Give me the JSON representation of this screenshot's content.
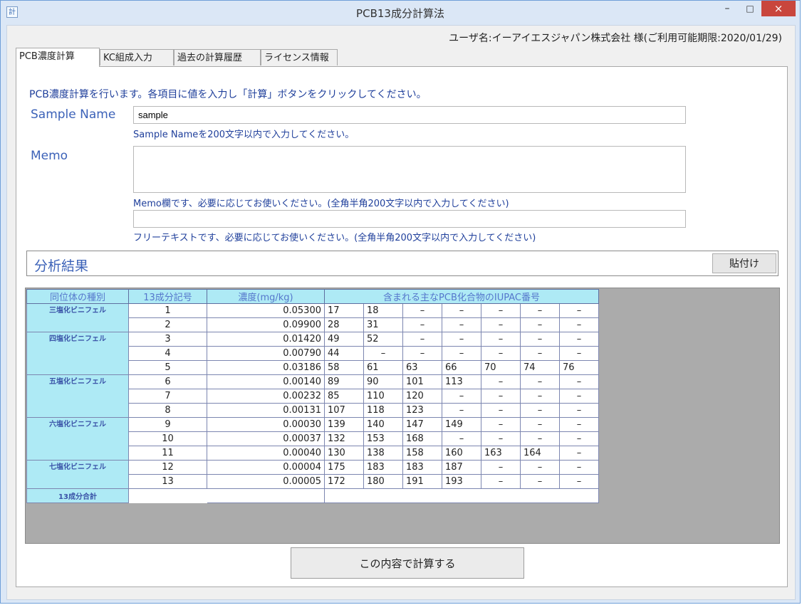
{
  "window": {
    "title": "PCB13成分計算法",
    "app_icon": "app-icon",
    "minimize": "–",
    "maximize": "□",
    "close": "×"
  },
  "user_info": "ユーザ名:イーアイエスジャパン株式会社 様(ご利用可能期限:2020/01/29)",
  "tabs": [
    "PCB濃度計算",
    "KC組成入力",
    "過去の計算履歴",
    "ライセンス情報"
  ],
  "intro": "PCB濃度計算を行います。各項目に値を入力し「計算」ボタンをクリックしてください。",
  "sample_name": {
    "label": "Sample Name",
    "value": "sample",
    "hint": "Sample Nameを200文字以内で入力してください。"
  },
  "memo": {
    "label": "Memo",
    "value": "",
    "hint": "Memo欄です、必要に応じてお使いください。(全角半角200文字以内で入力してください)"
  },
  "free_text": {
    "value": "",
    "hint": "フリーテキストです、必要に応じてお使いください。(全角半角200文字以内で入力してください)"
  },
  "results": {
    "title": "分析結果",
    "paste_button": "貼付け",
    "headers": [
      "同位体の種別",
      "13成分記号",
      "濃度(mg/kg)",
      "含まれる主なPCB化合物のIUPAC番号"
    ],
    "groups": [
      {
        "name": "三塩化ビニフェル",
        "rows": [
          {
            "code": "1",
            "conc": "0.05300",
            "iupac": [
              "17",
              "18",
              "–",
              "–",
              "–",
              "–",
              "–"
            ]
          },
          {
            "code": "2",
            "conc": "0.09900",
            "iupac": [
              "28",
              "31",
              "–",
              "–",
              "–",
              "–",
              "–"
            ]
          }
        ]
      },
      {
        "name": "四塩化ビニフェル",
        "rows": [
          {
            "code": "3",
            "conc": "0.01420",
            "iupac": [
              "49",
              "52",
              "–",
              "–",
              "–",
              "–",
              "–"
            ]
          },
          {
            "code": "4",
            "conc": "0.00790",
            "iupac": [
              "44",
              "–",
              "–",
              "–",
              "–",
              "–",
              "–"
            ]
          },
          {
            "code": "5",
            "conc": "0.03186",
            "iupac": [
              "58",
              "61",
              "63",
              "66",
              "70",
              "74",
              "76"
            ]
          }
        ]
      },
      {
        "name": "五塩化ビニフェル",
        "rows": [
          {
            "code": "6",
            "conc": "0.00140",
            "iupac": [
              "89",
              "90",
              "101",
              "113",
              "–",
              "–",
              "–"
            ]
          },
          {
            "code": "7",
            "conc": "0.00232",
            "iupac": [
              "85",
              "110",
              "120",
              "–",
              "–",
              "–",
              "–"
            ]
          },
          {
            "code": "8",
            "conc": "0.00131",
            "iupac": [
              "107",
              "118",
              "123",
              "–",
              "–",
              "–",
              "–"
            ]
          }
        ]
      },
      {
        "name": "六塩化ビニフェル",
        "rows": [
          {
            "code": "9",
            "conc": "0.00030",
            "iupac": [
              "139",
              "140",
              "147",
              "149",
              "–",
              "–",
              "–"
            ]
          },
          {
            "code": "10",
            "conc": "0.00037",
            "iupac": [
              "132",
              "153",
              "168",
              "–",
              "–",
              "–",
              "–"
            ]
          },
          {
            "code": "11",
            "conc": "0.00040",
            "iupac": [
              "130",
              "138",
              "158",
              "160",
              "163",
              "164",
              "–"
            ]
          }
        ]
      },
      {
        "name": "七塩化ビニフェル",
        "rows": [
          {
            "code": "12",
            "conc": "0.00004",
            "iupac": [
              "175",
              "183",
              "183",
              "187",
              "–",
              "–",
              "–"
            ]
          },
          {
            "code": "13",
            "conc": "0.00005",
            "iupac": [
              "172",
              "180",
              "191",
              "193",
              "–",
              "–",
              "–"
            ]
          }
        ]
      }
    ],
    "total_label": "13成分合計",
    "total_value": ""
  },
  "calc_button": "この内容で計算する"
}
